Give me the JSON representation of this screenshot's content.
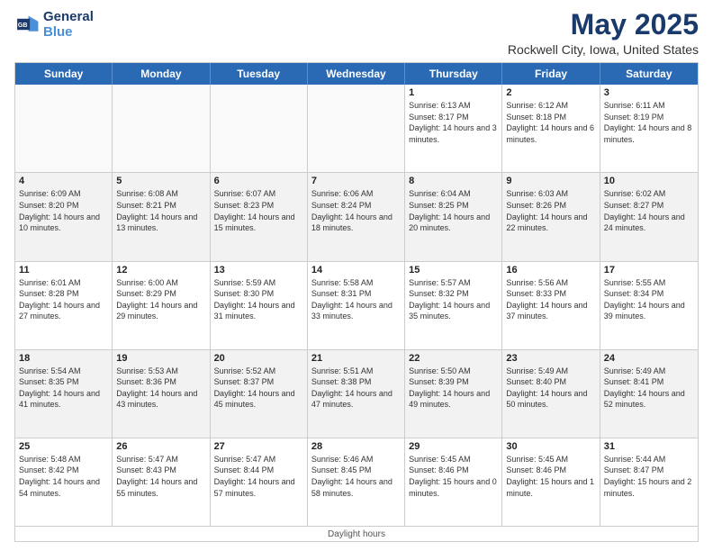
{
  "logo": {
    "line1": "General",
    "line2": "Blue"
  },
  "title": "May 2025",
  "subtitle": "Rockwell City, Iowa, United States",
  "days": [
    "Sunday",
    "Monday",
    "Tuesday",
    "Wednesday",
    "Thursday",
    "Friday",
    "Saturday"
  ],
  "weeks": [
    [
      {
        "day": "",
        "empty": true
      },
      {
        "day": "",
        "empty": true
      },
      {
        "day": "",
        "empty": true
      },
      {
        "day": "",
        "empty": true
      },
      {
        "day": "1",
        "rise": "6:13 AM",
        "set": "8:17 PM",
        "daylight": "14 hours and 3 minutes."
      },
      {
        "day": "2",
        "rise": "6:12 AM",
        "set": "8:18 PM",
        "daylight": "14 hours and 6 minutes."
      },
      {
        "day": "3",
        "rise": "6:11 AM",
        "set": "8:19 PM",
        "daylight": "14 hours and 8 minutes."
      }
    ],
    [
      {
        "day": "4",
        "rise": "6:09 AM",
        "set": "8:20 PM",
        "daylight": "14 hours and 10 minutes."
      },
      {
        "day": "5",
        "rise": "6:08 AM",
        "set": "8:21 PM",
        "daylight": "14 hours and 13 minutes."
      },
      {
        "day": "6",
        "rise": "6:07 AM",
        "set": "8:23 PM",
        "daylight": "14 hours and 15 minutes."
      },
      {
        "day": "7",
        "rise": "6:06 AM",
        "set": "8:24 PM",
        "daylight": "14 hours and 18 minutes."
      },
      {
        "day": "8",
        "rise": "6:04 AM",
        "set": "8:25 PM",
        "daylight": "14 hours and 20 minutes."
      },
      {
        "day": "9",
        "rise": "6:03 AM",
        "set": "8:26 PM",
        "daylight": "14 hours and 22 minutes."
      },
      {
        "day": "10",
        "rise": "6:02 AM",
        "set": "8:27 PM",
        "daylight": "14 hours and 24 minutes."
      }
    ],
    [
      {
        "day": "11",
        "rise": "6:01 AM",
        "set": "8:28 PM",
        "daylight": "14 hours and 27 minutes."
      },
      {
        "day": "12",
        "rise": "6:00 AM",
        "set": "8:29 PM",
        "daylight": "14 hours and 29 minutes."
      },
      {
        "day": "13",
        "rise": "5:59 AM",
        "set": "8:30 PM",
        "daylight": "14 hours and 31 minutes."
      },
      {
        "day": "14",
        "rise": "5:58 AM",
        "set": "8:31 PM",
        "daylight": "14 hours and 33 minutes."
      },
      {
        "day": "15",
        "rise": "5:57 AM",
        "set": "8:32 PM",
        "daylight": "14 hours and 35 minutes."
      },
      {
        "day": "16",
        "rise": "5:56 AM",
        "set": "8:33 PM",
        "daylight": "14 hours and 37 minutes."
      },
      {
        "day": "17",
        "rise": "5:55 AM",
        "set": "8:34 PM",
        "daylight": "14 hours and 39 minutes."
      }
    ],
    [
      {
        "day": "18",
        "rise": "5:54 AM",
        "set": "8:35 PM",
        "daylight": "14 hours and 41 minutes."
      },
      {
        "day": "19",
        "rise": "5:53 AM",
        "set": "8:36 PM",
        "daylight": "14 hours and 43 minutes."
      },
      {
        "day": "20",
        "rise": "5:52 AM",
        "set": "8:37 PM",
        "daylight": "14 hours and 45 minutes."
      },
      {
        "day": "21",
        "rise": "5:51 AM",
        "set": "8:38 PM",
        "daylight": "14 hours and 47 minutes."
      },
      {
        "day": "22",
        "rise": "5:50 AM",
        "set": "8:39 PM",
        "daylight": "14 hours and 49 minutes."
      },
      {
        "day": "23",
        "rise": "5:49 AM",
        "set": "8:40 PM",
        "daylight": "14 hours and 50 minutes."
      },
      {
        "day": "24",
        "rise": "5:49 AM",
        "set": "8:41 PM",
        "daylight": "14 hours and 52 minutes."
      }
    ],
    [
      {
        "day": "25",
        "rise": "5:48 AM",
        "set": "8:42 PM",
        "daylight": "14 hours and 54 minutes."
      },
      {
        "day": "26",
        "rise": "5:47 AM",
        "set": "8:43 PM",
        "daylight": "14 hours and 55 minutes."
      },
      {
        "day": "27",
        "rise": "5:47 AM",
        "set": "8:44 PM",
        "daylight": "14 hours and 57 minutes."
      },
      {
        "day": "28",
        "rise": "5:46 AM",
        "set": "8:45 PM",
        "daylight": "14 hours and 58 minutes."
      },
      {
        "day": "29",
        "rise": "5:45 AM",
        "set": "8:46 PM",
        "daylight": "15 hours and 0 minutes."
      },
      {
        "day": "30",
        "rise": "5:45 AM",
        "set": "8:46 PM",
        "daylight": "15 hours and 1 minute."
      },
      {
        "day": "31",
        "rise": "5:44 AM",
        "set": "8:47 PM",
        "daylight": "15 hours and 2 minutes."
      }
    ]
  ],
  "footer": "Daylight hours"
}
